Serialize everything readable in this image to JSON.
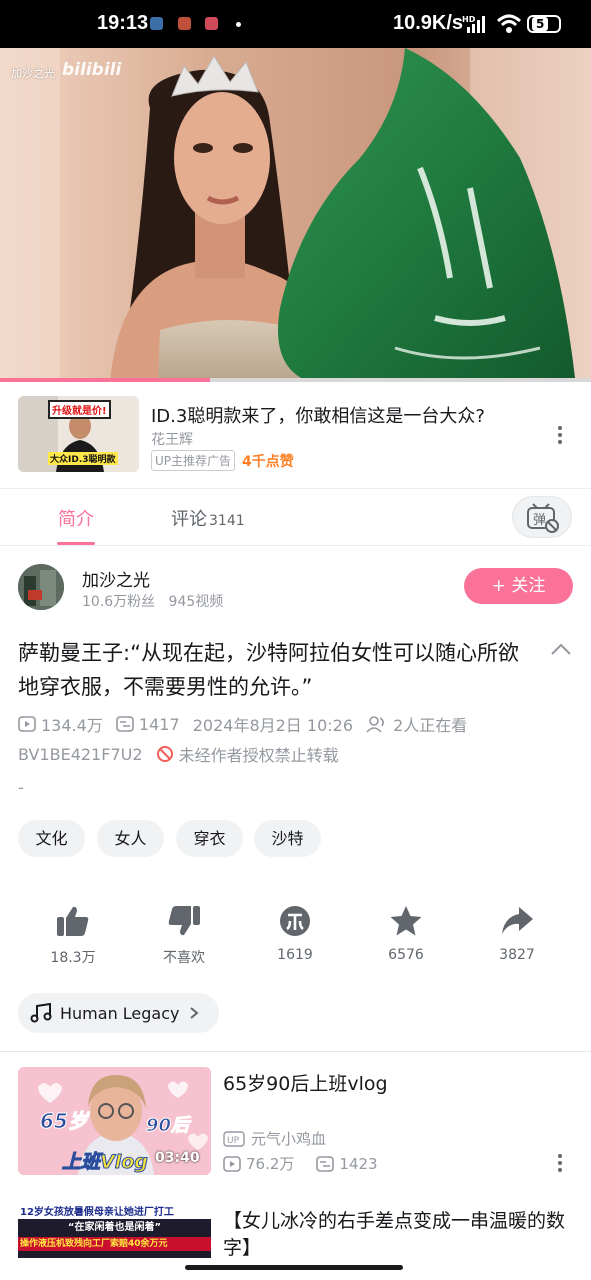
{
  "status_bar": {
    "time": "19:13",
    "network_speed": "10.9K/s",
    "battery": "5"
  },
  "player": {
    "watermark_channel": "加沙之光",
    "watermark_logo": "bilibili",
    "progress": 0.355
  },
  "ad": {
    "thumb_text1": "升级就是价!",
    "thumb_text2": "大众ID.3聪明款",
    "title": "ID.3聪明款来了，你敢相信这是一台大众?",
    "author": "花王辉",
    "tag": "UP主推荐广告",
    "likes": "4千点赞"
  },
  "tabs": {
    "intro": "简介",
    "comments": "评论",
    "comments_count": "3141",
    "danmaku_icon_text": "弹"
  },
  "uploader": {
    "name": "加沙之光",
    "fans": "10.6万粉丝",
    "videos": "945视频",
    "follow_label": "+ 关注"
  },
  "video": {
    "title": "萨勒曼王子:“从现在起，沙特阿拉伯女性可以随心所欲地穿衣服，不需要男性的允许。”",
    "views": "134.4万",
    "danmaku": "1417",
    "date": "2024年8月2日 10:26",
    "watching": "2人正在看",
    "bvid": "BV1BE421F7U2",
    "no_repost": "未经作者授权禁止转载",
    "description": "-"
  },
  "tags": [
    "文化",
    "女人",
    "穿衣",
    "沙特"
  ],
  "actions": {
    "like": "18.3万",
    "dislike": "不喜欢",
    "coin": "1619",
    "favorite": "6576",
    "share": "3827"
  },
  "music": {
    "title": "Human Legacy"
  },
  "recommendations": [
    {
      "title": "65岁90后上班vlog",
      "up": "元气小鸡血",
      "views": "76.2万",
      "danmaku": "1423",
      "duration": "03:40",
      "thumb_text_a": "65岁",
      "thumb_text_b": "90后",
      "thumb_text_c": "上班Vlog"
    },
    {
      "title": "【女儿冰冷的右手差点变成一串温暖的数字】",
      "thumb_line1": "12岁女孩放暑假母亲让她进厂打工",
      "thumb_line2": "“在家闲着也是闲着”",
      "thumb_line3": "操作液压机致残向工厂索赔40余万元"
    }
  ],
  "colors": {
    "brand_pink": "#fb7299",
    "ad_orange": "#ff7f24",
    "gray_text": "#9499a0",
    "flag_green": "#1f7a3e"
  }
}
